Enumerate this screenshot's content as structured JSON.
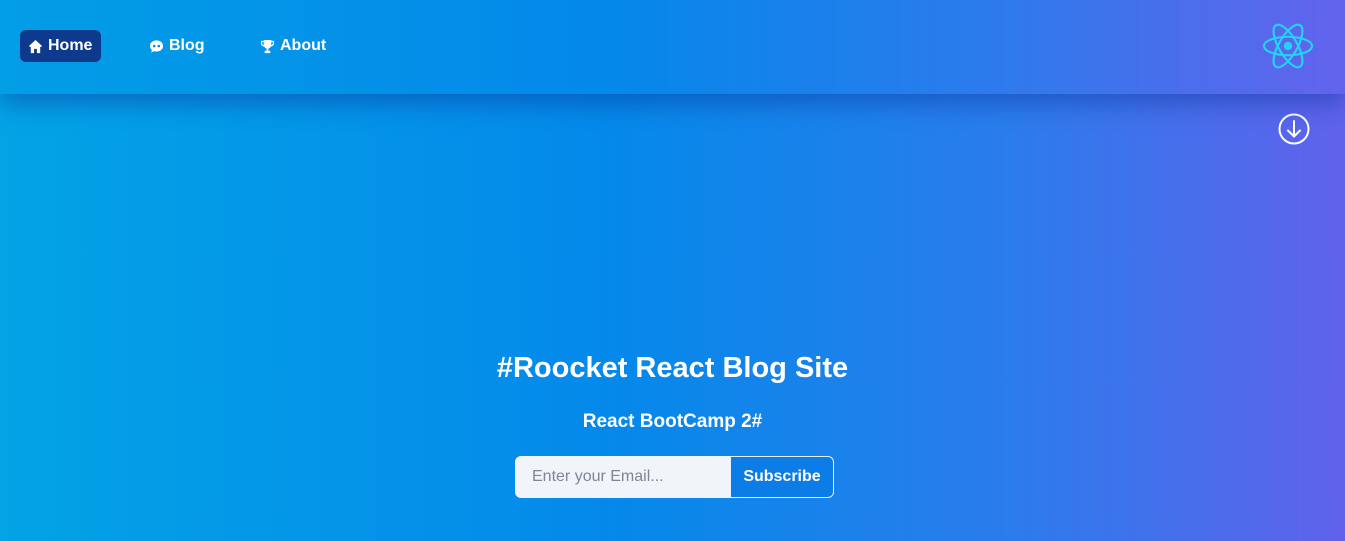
{
  "nav": {
    "items": [
      {
        "label": "Home",
        "icon": "home-icon",
        "active": true
      },
      {
        "label": "Blog",
        "icon": "chat-icon",
        "active": false
      },
      {
        "label": "About",
        "icon": "trophy-icon",
        "active": false
      }
    ],
    "logo_icon": "react-logo-icon"
  },
  "scroll": {
    "icon": "arrow-down-circle-icon"
  },
  "hero": {
    "title": "#Roocket React Blog Site",
    "subtitle": "React BootCamp 2#"
  },
  "subscribe": {
    "placeholder": "Enter your Email...",
    "value": "",
    "button_label": "Subscribe"
  },
  "colors": {
    "gradient_start": "#03a3e6",
    "gradient_mid": "#0489ea",
    "gradient_end": "#6162ec",
    "active_nav": "#0d3a8c",
    "react_logo": "#22d3f5",
    "input_bg": "#f1f5f9",
    "button_bg": "#0c7ce6"
  }
}
